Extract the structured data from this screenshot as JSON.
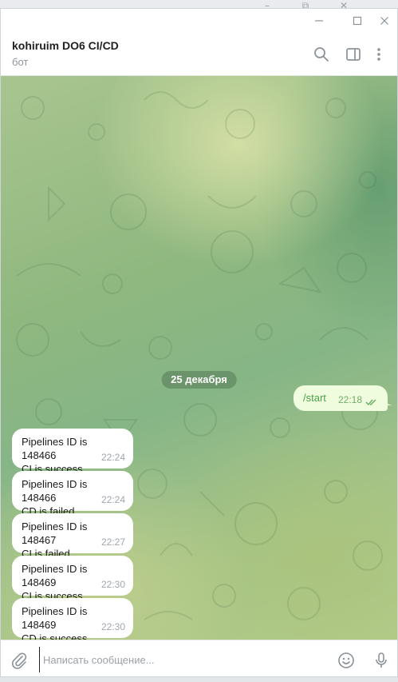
{
  "window": {
    "controls": [
      "minimize",
      "maximize",
      "close"
    ]
  },
  "header": {
    "title": "kohiruim DO6 CI/CD",
    "subtitle": "бот",
    "icons": [
      "search-icon",
      "sidebar-toggle-icon",
      "more-vertical-icon"
    ]
  },
  "chat": {
    "date_divider": "25 декабря",
    "outgoing": [
      {
        "text": "/start",
        "time": "22:18",
        "status": "read"
      }
    ],
    "incoming": [
      {
        "line1": "Pipelines ID is 148466",
        "line2": "CI is success",
        "time": "22:24"
      },
      {
        "line1": "Pipelines ID is 148466",
        "line2": "CD is failed",
        "time": "22:24"
      },
      {
        "line1": "Pipelines ID is 148467",
        "line2": "CI is failed",
        "time": "22:27"
      },
      {
        "line1": "Pipelines ID is 148469",
        "line2": "CI is success",
        "time": "22:30"
      },
      {
        "line1": "Pipelines ID is 148469",
        "line2": "CD is success",
        "time": "22:30"
      }
    ]
  },
  "composer": {
    "placeholder": "Написать сообщение...",
    "value": "",
    "icons": [
      "attach-icon",
      "emoji-icon",
      "microphone-icon"
    ]
  },
  "colors": {
    "outgoing_bubble": "#effdde",
    "incoming_bubble": "#ffffff",
    "accent_green": "#4aa249",
    "muted_text": "#8e969c"
  }
}
